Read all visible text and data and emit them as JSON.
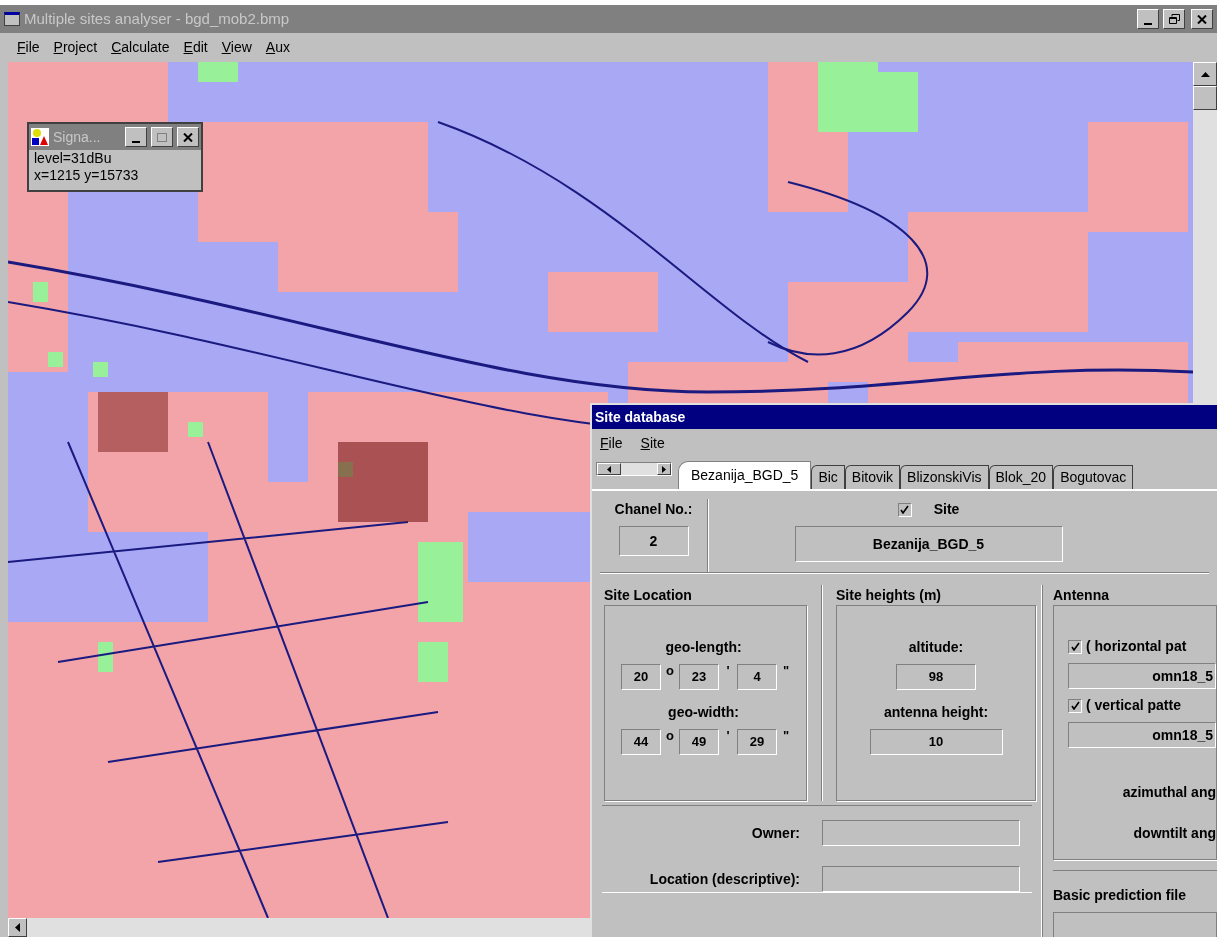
{
  "main_window": {
    "title": "Multiple sites analyser - bgd_mob2.bmp",
    "menu": [
      "File",
      "Project",
      "Calculate",
      "Edit",
      "View",
      "Aux"
    ]
  },
  "signal_window": {
    "title": "Signa...",
    "lines": [
      "level=31dBu",
      "x=1215 y=15733"
    ]
  },
  "site_database": {
    "title": "Site database",
    "menu": [
      "File",
      "Site"
    ],
    "tabs": [
      {
        "label": "Bezanija_BGD_5",
        "selected": true
      },
      {
        "label": "Bic",
        "selected": false
      },
      {
        "label": "Bitovik",
        "selected": false
      },
      {
        "label": "BlizonskiVis",
        "selected": false
      },
      {
        "label": "Blok_20",
        "selected": false
      },
      {
        "label": "Bogutovac",
        "selected": false
      }
    ],
    "channel": {
      "label": "Chanel No.:",
      "value": "2"
    },
    "site": {
      "label": "Site",
      "checked": true,
      "value": "Bezanija_BGD_5"
    },
    "site_location": {
      "title": "Site Location",
      "rows": [
        {
          "label": "geo-length:",
          "values": [
            "20",
            "23",
            "4"
          ],
          "units": [
            "o",
            "'",
            "\""
          ]
        },
        {
          "label": "geo-width:",
          "values": [
            "44",
            "49",
            "29"
          ],
          "units": [
            "o",
            "'",
            "\""
          ]
        }
      ]
    },
    "site_heights": {
      "title": "Site heights (m)",
      "rows": [
        {
          "label": "altitude:",
          "value": "98"
        },
        {
          "label": "antenna height:",
          "value": "10"
        }
      ]
    },
    "antenna": {
      "title": "Antenna",
      "patterns": [
        {
          "label": "( horizontal pat",
          "checked": true,
          "value": "omn18_5"
        },
        {
          "label": "( vertical patte",
          "checked": true,
          "value": "omn18_5"
        }
      ],
      "angles": [
        "azimuthal ang",
        "downtilt ang"
      ]
    },
    "details": [
      {
        "label": "Owner:"
      },
      {
        "label": "Location (descriptive):"
      }
    ],
    "prediction": {
      "title": "Basic prediction file"
    }
  }
}
